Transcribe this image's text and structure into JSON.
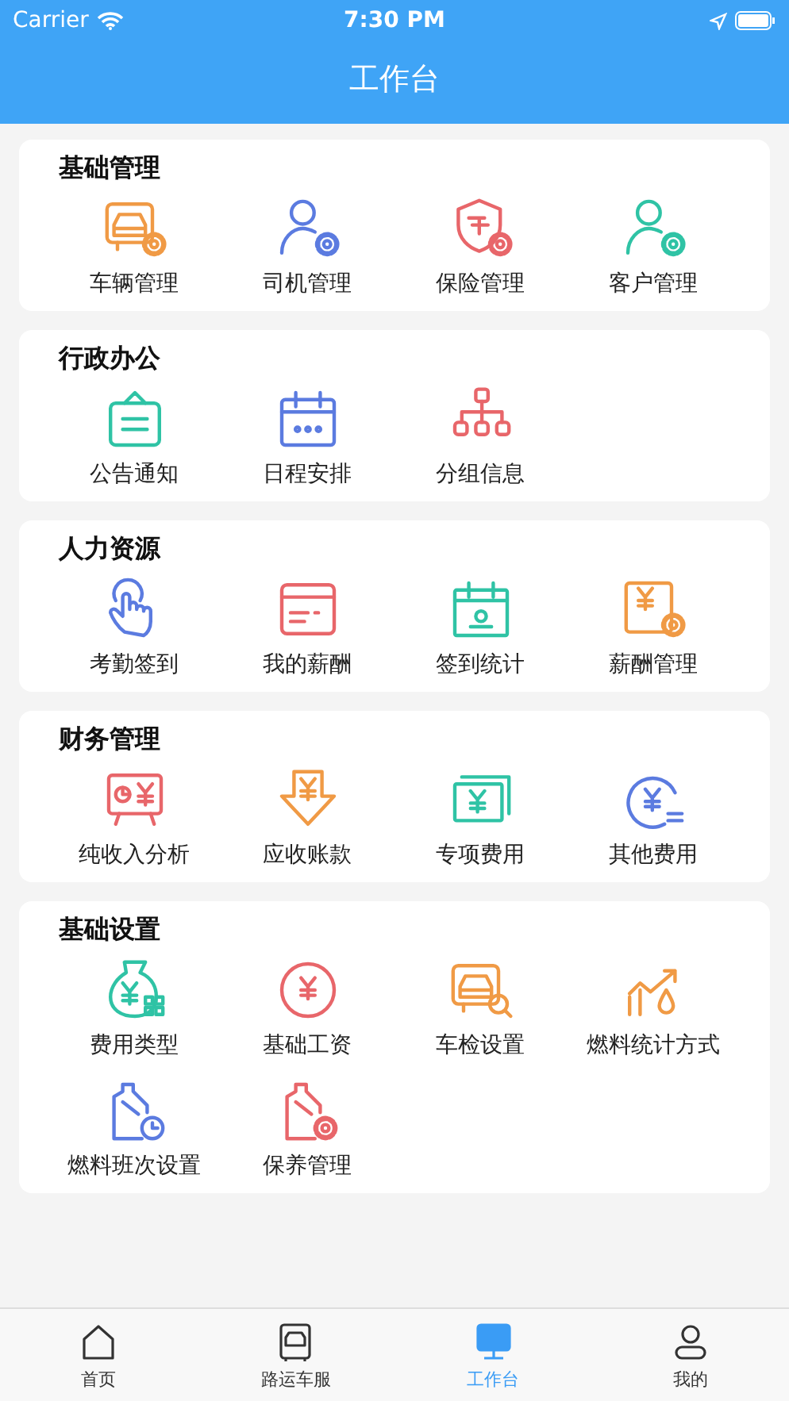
{
  "status_bar": {
    "carrier": "Carrier",
    "time": "7:30 PM"
  },
  "header": {
    "title": "工作台"
  },
  "sections": [
    {
      "title": "基础管理",
      "items": [
        {
          "label": "车辆管理",
          "color": "#f09a45"
        },
        {
          "label": "司机管理",
          "color": "#5b7be0"
        },
        {
          "label": "保险管理",
          "color": "#e8666a"
        },
        {
          "label": "客户管理",
          "color": "#2fc3a5"
        }
      ]
    },
    {
      "title": "行政办公",
      "items": [
        {
          "label": "公告通知",
          "color": "#2fc3a5"
        },
        {
          "label": "日程安排",
          "color": "#5b7be0"
        },
        {
          "label": "分组信息",
          "color": "#e8666a"
        }
      ]
    },
    {
      "title": "人力资源",
      "items": [
        {
          "label": "考勤签到",
          "color": "#5b7be0"
        },
        {
          "label": "我的薪酬",
          "color": "#e8666a"
        },
        {
          "label": "签到统计",
          "color": "#2fc3a5"
        },
        {
          "label": "薪酬管理",
          "color": "#f09a45"
        }
      ]
    },
    {
      "title": "财务管理",
      "items": [
        {
          "label": "纯收入分析",
          "color": "#e8666a"
        },
        {
          "label": "应收账款",
          "color": "#f09a45"
        },
        {
          "label": "专项费用",
          "color": "#2fc3a5"
        },
        {
          "label": "其他费用",
          "color": "#5b7be0"
        }
      ]
    },
    {
      "title": "基础设置",
      "items": [
        {
          "label": "费用类型",
          "color": "#2fc3a5"
        },
        {
          "label": "基础工资",
          "color": "#e8666a"
        },
        {
          "label": "车检设置",
          "color": "#f09a45"
        },
        {
          "label": "燃料统计方式",
          "color": "#f09a45"
        },
        {
          "label": "燃料班次设置",
          "color": "#5b7be0"
        },
        {
          "label": "保养管理",
          "color": "#e8666a"
        }
      ]
    }
  ],
  "tab_bar": [
    {
      "label": "首页",
      "selected": false
    },
    {
      "label": "路运车服",
      "selected": false
    },
    {
      "label": "工作台",
      "selected": true
    },
    {
      "label": "我的",
      "selected": false
    }
  ]
}
